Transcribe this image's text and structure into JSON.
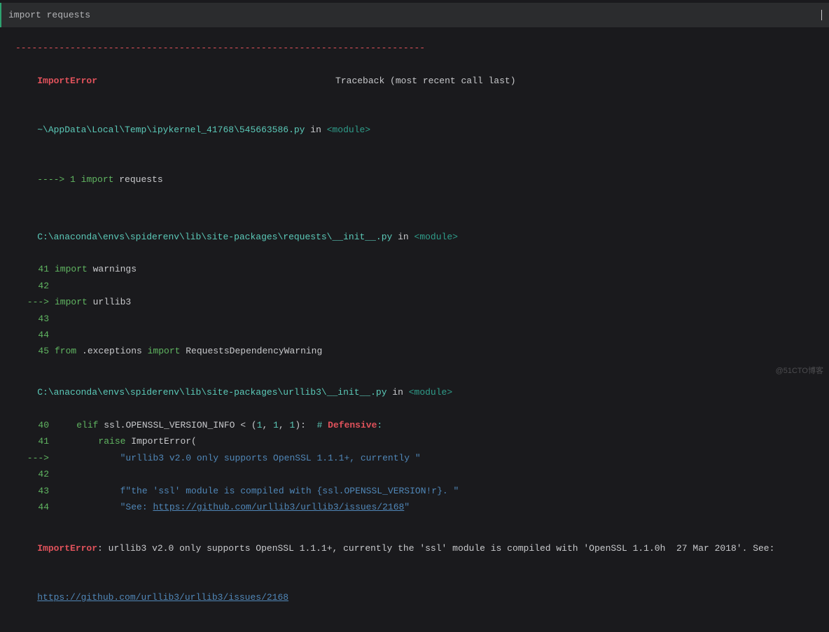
{
  "cell": {
    "input": "import requests"
  },
  "dashes": "---------------------------------------------------------------------------",
  "error": {
    "name": "ImportError",
    "tb_label": "Traceback (most recent call last)"
  },
  "tb1": {
    "path": "~\\AppData\\Local\\Temp\\ipykernel_41768\\545663586.py",
    "in": " in ",
    "module": "<module>",
    "arrow": "----> 1 ",
    "import_kw": "import",
    "rest": " requests"
  },
  "frame2": {
    "path": "C:\\anaconda\\envs\\spiderenv\\lib\\site-packages\\requests\\__init__.py",
    "in": " in ",
    "module": "<module>",
    "rows": {
      "r41": {
        "no": "41",
        "import": "import",
        "rest": " warnings"
      },
      "r42": {
        "no": "42",
        "rest": " "
      },
      "r43arrow": "---> ",
      "r43": {
        "no": "43",
        "import": "import",
        "rest": " urllib3"
      },
      "r44": {
        "no": "44",
        "rest": " "
      },
      "r45": {
        "no": "45",
        "from": "from",
        "mid": " .exceptions ",
        "import": "import",
        "rest": " RequestsDependencyWarning"
      }
    }
  },
  "frame3": {
    "path": "C:\\anaconda\\envs\\spiderenv\\lib\\site-packages\\urllib3\\__init__.py",
    "in": " in ",
    "module": "<module>",
    "rows": {
      "r40": {
        "no": "40",
        "indent": "    ",
        "elif": "elif",
        "body1": " ssl.OPENSSL_VERSION_INFO < (",
        "n1": "1",
        "c1": ", ",
        "n2": "1",
        "c2": ", ",
        "n3": "1",
        "body2": "):  ",
        "hash": "# ",
        "def": "Defensive",
        "colon2": ":"
      },
      "r41": {
        "no": "41",
        "indent": "        ",
        "raise": "raise",
        "rest": " ImportError("
      },
      "r42arrow": "---> ",
      "r42": {
        "no": "42",
        "indent": "            ",
        "str": "\"urllib3 v2.0 only supports OpenSSL 1.1.1+, currently \""
      },
      "r43": {
        "no": "43",
        "indent": "            ",
        "str": "f\"the 'ssl' module is compiled with {ssl.OPENSSL_VERSION!r}. \""
      },
      "r44": {
        "no": "44",
        "indent": "            ",
        "str_pre": "\"See: ",
        "link": "https://github.com/urllib3/urllib3/issues/2168",
        "str_post": "\""
      }
    }
  },
  "final": {
    "name": "ImportError",
    "colon": ": ",
    "msg": "urllib3 v2.0 only supports OpenSSL 1.1.1+, currently the 'ssl' module is compiled with 'OpenSSL 1.1.0h  27 Mar 2018'. See: ",
    "link": "https://github.com/urllib3/urllib3/issues/2168"
  },
  "watermark": "@51CTO博客"
}
